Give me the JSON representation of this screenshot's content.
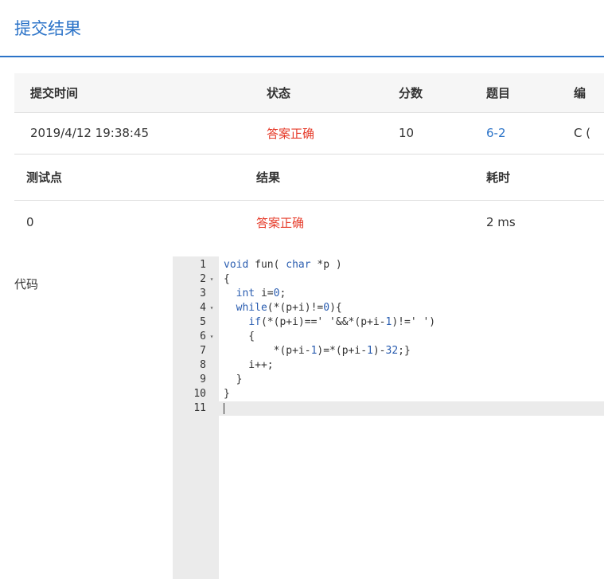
{
  "page": {
    "title": "提交结果"
  },
  "submission": {
    "headers": [
      "提交时间",
      "状态",
      "分数",
      "题目",
      "编"
    ],
    "row": {
      "time": "2019/4/12 19:38:45",
      "status": "答案正确",
      "score": "10",
      "problem": "6-2",
      "compiler": "C ("
    }
  },
  "testcases": {
    "headers": [
      "测试点",
      "结果",
      "耗时"
    ],
    "rows": [
      {
        "id": "0",
        "result": "答案正确",
        "time": "2 ms"
      }
    ]
  },
  "code": {
    "label": "代码",
    "lines": [
      {
        "n": "1",
        "fold": "",
        "text": "void fun( char *p )"
      },
      {
        "n": "2",
        "fold": "▾",
        "text": "{"
      },
      {
        "n": "3",
        "fold": "",
        "text": "  int i=0;"
      },
      {
        "n": "4",
        "fold": "▾",
        "text": "  while(*(p+i)!=0){"
      },
      {
        "n": "5",
        "fold": "",
        "text": "    if(*(p+i)==' '&&*(p+i-1)!=' ')"
      },
      {
        "n": "6",
        "fold": "▾",
        "text": "    {"
      },
      {
        "n": "7",
        "fold": "",
        "text": "        *(p+i-1)=*(p+i-1)-32;}"
      },
      {
        "n": "8",
        "fold": "",
        "text": "    i++;"
      },
      {
        "n": "9",
        "fold": "",
        "text": "  }"
      },
      {
        "n": "10",
        "fold": "",
        "text": "}"
      },
      {
        "n": "11",
        "fold": "",
        "text": ""
      }
    ]
  },
  "colors": {
    "accent": "#2b73c8",
    "status_ok": "#e63b2a",
    "header_bg": "#f6f6f6",
    "gutter_bg": "#ebebeb"
  }
}
